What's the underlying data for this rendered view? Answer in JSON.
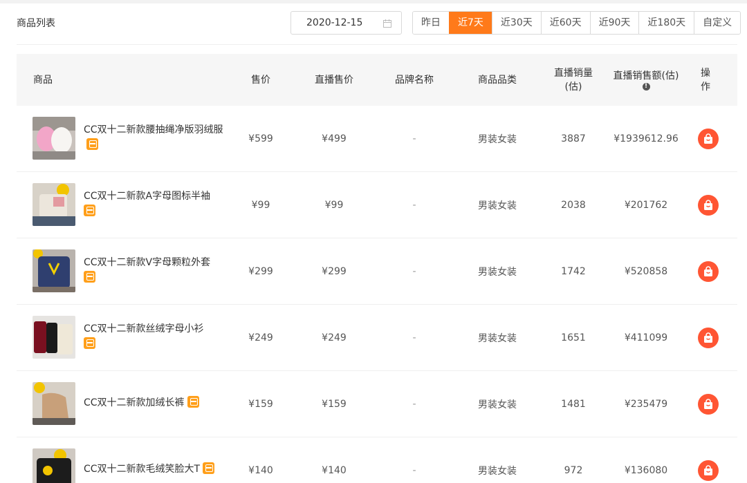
{
  "header": {
    "title": "商品列表",
    "date": "2020-12-15",
    "ranges": [
      "昨日",
      "近7天",
      "近30天",
      "近60天",
      "近90天",
      "近180天",
      "自定义"
    ],
    "active_range": "近7天"
  },
  "columns": {
    "product": "商品",
    "price": "售价",
    "live_price": "直播售价",
    "brand": "品牌名称",
    "category": "商品品类",
    "live_sales_l1": "直播销量",
    "live_sales_l2": "(估)",
    "live_revenue": "直播销售额(估)",
    "action_l1": "操",
    "action_l2": "作"
  },
  "colors": {
    "accent": "#ff7a1a",
    "action": "#ff5533",
    "tag": "#ff9f1a"
  },
  "rows": [
    {
      "name": "CC双十二新款腰抽绳净版羽绒服",
      "price": "¥599",
      "live_price": "¥499",
      "brand": "-",
      "category": "男装女装",
      "sales": "3887",
      "revenue": "¥1939612.96"
    },
    {
      "name": "CC双十二新款A字母图标半袖",
      "price": "¥99",
      "live_price": "¥99",
      "brand": "-",
      "category": "男装女装",
      "sales": "2038",
      "revenue": "¥201762"
    },
    {
      "name": "CC双十二新款V字母颗粒外套",
      "price": "¥299",
      "live_price": "¥299",
      "brand": "-",
      "category": "男装女装",
      "sales": "1742",
      "revenue": "¥520858"
    },
    {
      "name": "CC双十二新款丝绒字母小衫",
      "price": "¥249",
      "live_price": "¥249",
      "brand": "-",
      "category": "男装女装",
      "sales": "1651",
      "revenue": "¥411099"
    },
    {
      "name": "CC双十二新款加绒长裤",
      "price": "¥159",
      "live_price": "¥159",
      "brand": "-",
      "category": "男装女装",
      "sales": "1481",
      "revenue": "¥235479"
    },
    {
      "name": "CC双十二新款毛绒笑脸大T",
      "price": "¥140",
      "live_price": "¥140",
      "brand": "-",
      "category": "男装女装",
      "sales": "972",
      "revenue": "¥136080"
    }
  ]
}
